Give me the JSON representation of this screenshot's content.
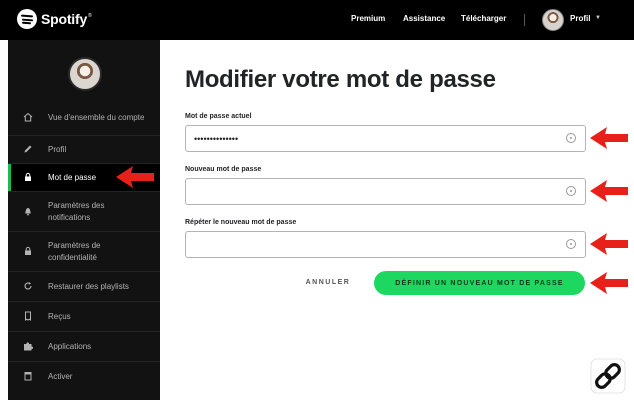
{
  "brand": {
    "name": "Spotify",
    "tm": "®",
    "icon": "spotify-logo-icon",
    "accent": "#1db954"
  },
  "topnav": {
    "items": [
      "Premium",
      "Assistance",
      "Télécharger"
    ],
    "profile_label": "Profil",
    "chevron": "chevron-down-icon"
  },
  "sidebar": {
    "items": [
      {
        "icon": "home-icon",
        "label": "Vue d'ensemble du compte"
      },
      {
        "icon": "pen-icon",
        "label": "Profil"
      },
      {
        "icon": "lock-icon",
        "label": "Mot de passe",
        "active": true
      },
      {
        "icon": "bell-icon",
        "label_lines": [
          "Paramètres des",
          "notifications"
        ]
      },
      {
        "icon": "lock-icon",
        "label_lines": [
          "Paramètres de",
          "confidentialité"
        ]
      },
      {
        "icon": "refresh-icon",
        "label": "Restaurer des playlists"
      },
      {
        "icon": "receipt-icon",
        "label": "Reçus"
      },
      {
        "icon": "puzzle-icon",
        "label": "Applications"
      },
      {
        "icon": "card-icon",
        "label": "Activer"
      }
    ]
  },
  "main": {
    "title": "Modifier votre mot de passe",
    "fields": [
      {
        "label": "Mot de passe actuel",
        "value": "••••••••••••••",
        "icon": "eye-icon"
      },
      {
        "label": "Nouveau mot de passe",
        "value": "",
        "icon": "eye-icon"
      },
      {
        "label": "Répéter le nouveau mot de passe",
        "value": "",
        "icon": "eye-icon"
      }
    ],
    "cancel_label": "ANNULER",
    "submit_label": "DÉFINIR UN NOUVEAU MOT DE PASSE",
    "submit_color": "#1ed760"
  },
  "annotations": {
    "arrow_color": "#e8201a",
    "arrow_icon": "red-arrow-icon",
    "watermark_icon": "link-icon"
  }
}
